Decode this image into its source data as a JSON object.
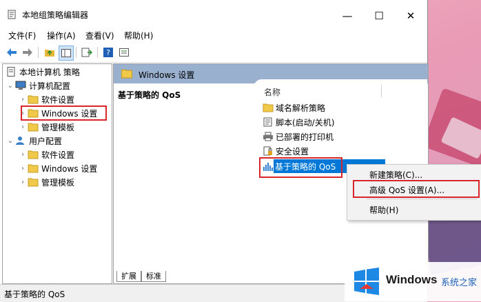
{
  "window": {
    "title": "本地组策略编辑器",
    "min": "—",
    "max": "☐",
    "close": "✕"
  },
  "menubar": [
    "文件(F)",
    "操作(A)",
    "查看(V)",
    "帮助(H)"
  ],
  "tree": {
    "root": "本地计算机 策略",
    "computer_config": "计算机配置",
    "computer_children": [
      "软件设置",
      "Windows 设置",
      "管理模板"
    ],
    "user_config": "用户配置",
    "user_children": [
      "软件设置",
      "Windows 设置",
      "管理模板"
    ]
  },
  "right_pane": {
    "header": "Windows 设置",
    "description_title": "基于策略的 QoS",
    "column_name": "名称",
    "items": [
      "域名解析策略",
      "脚本(启动/关机)",
      "已部署的打印机",
      "安全设置",
      "基于策略的 QoS"
    ]
  },
  "tabs": [
    "扩展",
    "标准"
  ],
  "context_menu": [
    "新建策略(C)...",
    "高级 QoS 设置(A)...",
    "帮助(H)"
  ],
  "status": "基于策略的 QoS",
  "watermark": {
    "brand": "Windows",
    "site": "系统之家"
  },
  "colors": {
    "selection": "#0078d7",
    "highlight_box": "#d9252a",
    "header_band": "#9ab0cf"
  }
}
